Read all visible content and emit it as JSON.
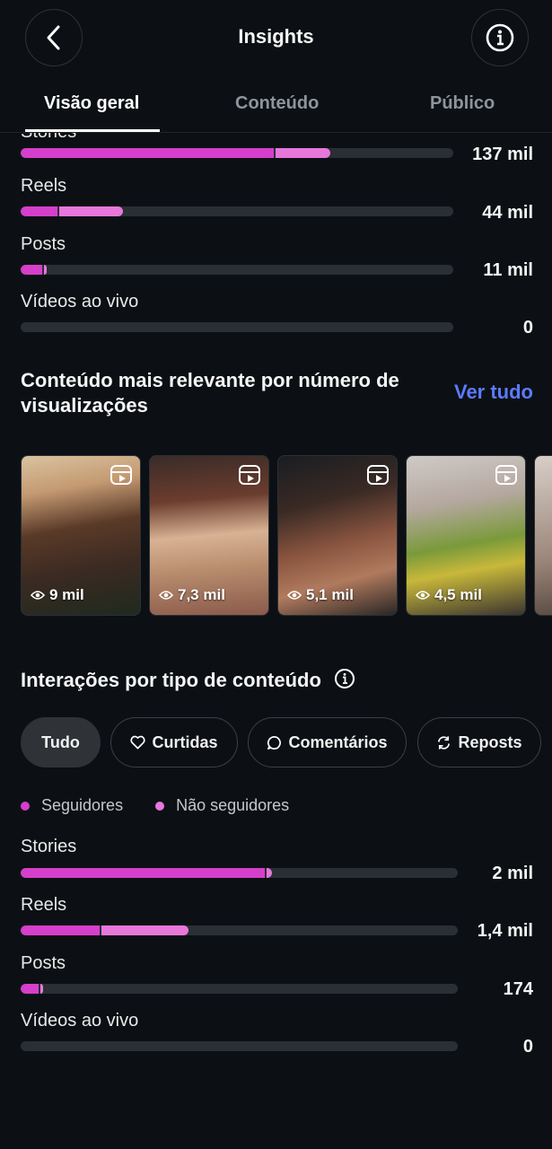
{
  "header": {
    "title": "Insights"
  },
  "tabs": [
    {
      "label": "Visão geral",
      "active": true
    },
    {
      "label": "Conteúdo",
      "active": false
    },
    {
      "label": "Público",
      "active": false
    }
  ],
  "colors": {
    "followers": "#d63fcb",
    "non_followers": "#e877dc",
    "track": "#2a2f35",
    "link": "#5b7bff"
  },
  "views_by_type": {
    "rows": [
      {
        "label": "Stories",
        "value": "137 mil",
        "followers_fraction": 0.585,
        "non_followers_fraction": 0.127
      },
      {
        "label": "Reels",
        "value": "44 mil",
        "followers_fraction": 0.085,
        "non_followers_fraction": 0.148
      },
      {
        "label": "Posts",
        "value": "11 mil",
        "followers_fraction": 0.05,
        "non_followers_fraction": 0.007
      },
      {
        "label": "Vídeos ao vivo",
        "value": "0",
        "followers_fraction": 0,
        "non_followers_fraction": 0
      }
    ]
  },
  "top_content": {
    "title": "Conteúdo mais relevante por número de visualizações",
    "see_all": "Ver tudo",
    "items": [
      {
        "views": "9 mil",
        "icon": "reels-icon"
      },
      {
        "views": "7,3 mil",
        "icon": "reels-icon"
      },
      {
        "views": "5,1 mil",
        "icon": "reels-icon"
      },
      {
        "views": "4,5 mil",
        "icon": "reels-icon"
      }
    ]
  },
  "interactions": {
    "title": "Interações por tipo de conteúdo",
    "filters": [
      {
        "label": "Tudo",
        "icon": "",
        "active": true
      },
      {
        "label": "Curtidas",
        "icon": "heart-icon",
        "active": false
      },
      {
        "label": "Comentários",
        "icon": "comment-icon",
        "active": false
      },
      {
        "label": "Reposts",
        "icon": "repost-icon",
        "active": false
      }
    ],
    "legend": {
      "followers": "Seguidores",
      "non_followers": "Não seguidores"
    },
    "rows": [
      {
        "label": "Stories",
        "value": "2 mil",
        "followers_fraction": 0.558,
        "non_followers_fraction": 0.012
      },
      {
        "label": "Reels",
        "value": "1,4 mil",
        "followers_fraction": 0.18,
        "non_followers_fraction": 0.2
      },
      {
        "label": "Posts",
        "value": "174",
        "followers_fraction": 0.042,
        "non_followers_fraction": 0.006
      },
      {
        "label": "Vídeos ao vivo",
        "value": "0",
        "followers_fraction": 0,
        "non_followers_fraction": 0
      }
    ]
  }
}
